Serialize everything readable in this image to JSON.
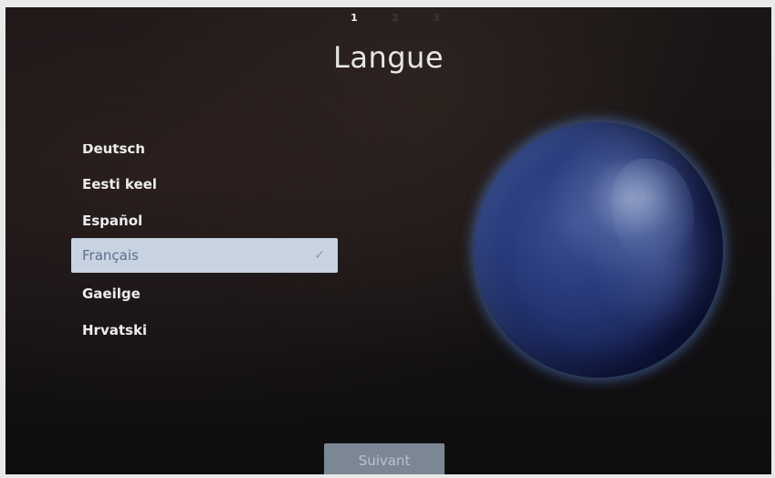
{
  "steps": {
    "current": "1",
    "second": "2",
    "third": "3"
  },
  "title": "Langue",
  "languages": {
    "partial": "Deutsch",
    "items": [
      "Eesti keel",
      "Español",
      "Français",
      "Gaeilge",
      "Hrvatski"
    ],
    "selected": "Français",
    "selected_icon": "✓"
  },
  "icons": {
    "selected_marker": "check-icon",
    "globe": "earth-globe-image"
  },
  "footer": {
    "next_label": "Suivant"
  },
  "colors": {
    "selected_background": "#c7d3e0",
    "button_background": "#7b8795",
    "globe_glow": "#5a8ce6"
  }
}
